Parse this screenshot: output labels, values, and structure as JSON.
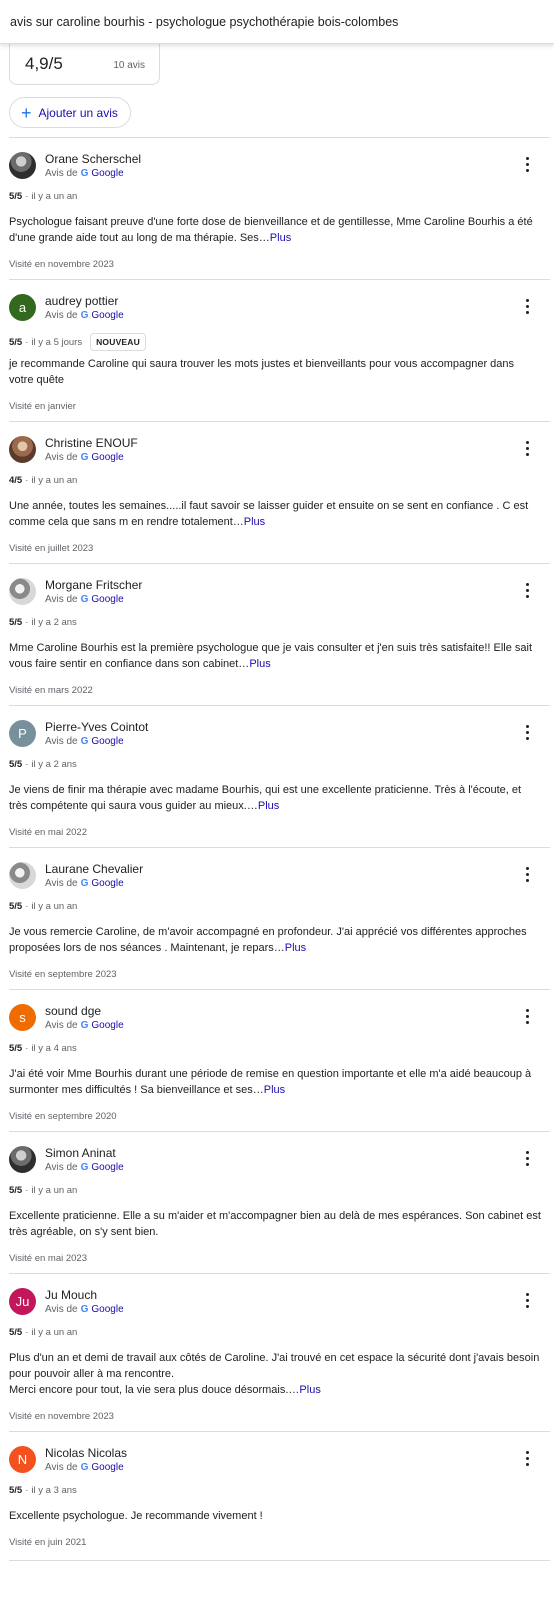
{
  "search": {
    "query": "avis sur caroline bourhis - psychologue psychothérapie bois-colombes"
  },
  "summary": {
    "score": "4,9/5",
    "count": "10 avis"
  },
  "add_review": {
    "icon": "plus-icon",
    "label": "Ajouter un avis"
  },
  "common": {
    "source_prefix": "Avis de",
    "source_name": "Google",
    "more_link": "Plus"
  },
  "colors": {
    "link": "#1a0dab",
    "accent": "#1a73e8"
  },
  "reviews": [
    {
      "name": "Orane Scherschel",
      "avatar_letter": "",
      "rating": "5/5",
      "time": "il y a un an",
      "badge": "",
      "text": "Psychologue faisant preuve d'une forte dose de bienveillance et de gentillesse, Mme Caroline Bourhis a été d'une grande aide tout au long de ma thérapie. Ses…",
      "has_more": true,
      "visited": "Visité en novembre 2023"
    },
    {
      "name": "audrey pottier",
      "avatar_letter": "a",
      "rating": "5/5",
      "time": "il y a 5 jours",
      "badge": "NOUVEAU",
      "text": "je recommande Caroline qui saura trouver les mots justes et bienveillants pour vous accompagner dans votre quête",
      "has_more": false,
      "visited": "Visité en janvier"
    },
    {
      "name": "Christine ENOUF",
      "avatar_letter": "",
      "rating": "4/5",
      "time": "il y a un an",
      "badge": "",
      "text": "Une année, toutes les semaines.....il faut savoir se laisser guider et ensuite on se sent en confiance . C est comme cela que sans m en rendre totalement…",
      "has_more": true,
      "visited": "Visité en juillet 2023"
    },
    {
      "name": "Morgane Fritscher",
      "avatar_letter": "",
      "rating": "5/5",
      "time": "il y a 2 ans",
      "badge": "",
      "text": "Mme Caroline Bourhis est la première psychologue que je vais consulter et j'en suis très satisfaite!! Elle sait vous faire sentir en confiance dans son cabinet…",
      "has_more": true,
      "visited": "Visité en mars 2022"
    },
    {
      "name": "Pierre-Yves Cointot",
      "avatar_letter": "P",
      "rating": "5/5",
      "time": "il y a 2 ans",
      "badge": "",
      "text": "Je viens de finir ma thérapie avec madame Bourhis, qui est une excellente praticienne. Très à l'écoute, et très compétente qui saura vous guider au mieux.…",
      "has_more": true,
      "visited": "Visité en mai 2022"
    },
    {
      "name": "Laurane Chevalier",
      "avatar_letter": "",
      "rating": "5/5",
      "time": "il y a un an",
      "badge": "",
      "text": "Je vous remercie Caroline, de m'avoir accompagné en profondeur. J'ai apprécié vos différentes approches proposées lors de nos séances . Maintenant, je repars…",
      "has_more": true,
      "visited": "Visité en septembre 2023"
    },
    {
      "name": "sound dge",
      "avatar_letter": "s",
      "rating": "5/5",
      "time": "il y a 4 ans",
      "badge": "",
      "text": "J'ai été voir Mme Bourhis durant une période de remise en question importante et elle m'a aidé beaucoup à surmonter mes difficultés ! Sa bienveillance et ses…",
      "has_more": true,
      "visited": "Visité en septembre 2020"
    },
    {
      "name": "Simon Aninat",
      "avatar_letter": "",
      "rating": "5/5",
      "time": "il y a un an",
      "badge": "",
      "text": "Excellente praticienne. Elle a su m'aider et m'accompagner bien au delà de mes espérances. Son cabinet est très agréable, on s'y sent bien.",
      "has_more": false,
      "visited": "Visité en mai 2023"
    },
    {
      "name": "Ju Mouch",
      "avatar_letter": "Ju",
      "rating": "5/5",
      "time": "il y a un an",
      "badge": "",
      "text": "Plus d'un an et demi de travail aux côtés de Caroline. J'ai trouvé en cet espace la sécurité dont j'avais besoin pour pouvoir aller à ma rencontre.\nMerci encore pour tout, la vie sera plus douce désormais.…",
      "has_more": true,
      "visited": "Visité en novembre 2023"
    },
    {
      "name": "Nicolas Nicolas",
      "avatar_letter": "N",
      "rating": "5/5",
      "time": "il y a 3 ans",
      "badge": "",
      "text": "Excellente psychologue. Je recommande vivement !",
      "has_more": false,
      "visited": "Visité en juin 2021"
    }
  ]
}
